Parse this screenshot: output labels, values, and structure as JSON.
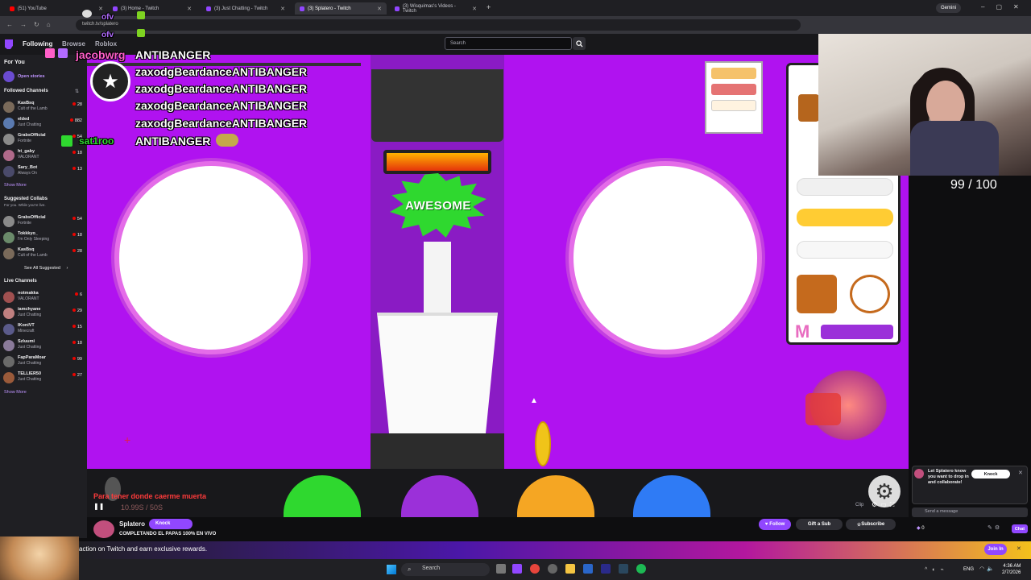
{
  "browser": {
    "tabs": [
      {
        "label": "(51) YouTube",
        "icon": "youtube-icon",
        "active": false
      },
      {
        "label": "(3) Home - Twitch",
        "icon": "twitch-icon",
        "active": false
      },
      {
        "label": "(3) Just Chatting - Twitch",
        "icon": "twitch-icon",
        "active": false
      },
      {
        "label": "(3) Splatero - Twitch",
        "icon": "twitch-icon",
        "active": true
      },
      {
        "label": "(3) Wisquimas's Videos - Twitch",
        "icon": "twitch-icon",
        "active": false
      }
    ],
    "url": "twitch.tv/splatero",
    "gemini_label": "Gemini"
  },
  "twitch_nav": {
    "following": "Following",
    "browse": "Browse",
    "roblox": "Roblox",
    "search_placeholder": "Search"
  },
  "sidebar": {
    "for_you": "For You",
    "open_stories": "Open stories",
    "followed_header": "Followed Channels",
    "followed": [
      {
        "name": "KasBsq",
        "game": "Cult of the Lamb",
        "viewers": "28"
      },
      {
        "name": "elded",
        "game": "Just Chatting",
        "viewers": "882"
      },
      {
        "name": "GrabsOfficial",
        "game": "Fortnite",
        "viewers": "54"
      },
      {
        "name": "ht_gaby",
        "game": "VALORANT",
        "viewers": "18"
      },
      {
        "name": "Sary_Bot",
        "game": "Always On",
        "viewers": "13"
      }
    ],
    "show_more_1": "Show More",
    "suggested_header": "Suggested Collabs",
    "suggested_sub": "For you. While you're live.",
    "suggested": [
      {
        "name": "GrabsOfficial",
        "game": "Fortnite",
        "viewers": "54"
      },
      {
        "name": "Tokkkyo_",
        "game": "I'm Only Sleeping",
        "viewers": "18"
      },
      {
        "name": "KasBsq",
        "game": "Cult of the Lamb",
        "viewers": "28"
      }
    ],
    "see_all_suggested": "See All Suggested",
    "live_header": "Live Channels",
    "live": [
      {
        "name": "notmakka",
        "game": "VALORANT",
        "viewers": "6"
      },
      {
        "name": "iamchyane",
        "game": "Just Chatting",
        "viewers": "29"
      },
      {
        "name": "IKoniVT",
        "game": "Minecraft",
        "viewers": "15"
      },
      {
        "name": "Szluumi",
        "game": "Just Chatting",
        "viewers": "18"
      },
      {
        "name": "FapParaMoar",
        "game": "Just Chatting",
        "viewers": "99"
      },
      {
        "name": "TELLIER50",
        "game": "Just Chatting",
        "viewers": "27"
      }
    ],
    "show_more_2": "Show More"
  },
  "overlay_chat": {
    "ofv_1": "ofv",
    "ofv_2": "ofv",
    "username": "jacobwrg",
    "lines": [
      "ANTIBANGER",
      "zaxodgBeardanceANTIBANGER",
      "zaxodgBeardanceANTIBANGER",
      "zaxodgBeardanceANTIBANGER",
      "zaxodgBeardanceANTIBANGER",
      "ANTIBANGER"
    ],
    "user2": "sat1roo"
  },
  "game": {
    "awesome_label": "AWESOME",
    "m_label": "M",
    "ticker_text": "Para tener donde caerme muerta",
    "ticker_sub": "10.99S / 50S"
  },
  "webcam": {
    "counter": "99 / 100"
  },
  "stream_info": {
    "streamer": "Splatero",
    "knock_label": "Knock",
    "title": "COMPLETANDO EL PAPAS 100% EN VIVO",
    "follow_label": "Follow",
    "gift_label": "Gift a Sub",
    "subscribe_label": "Subscribe",
    "clip_label": "Clip"
  },
  "chat_panel": {
    "collab_text": "Let Splatero know you want to drop in and collaborate!",
    "collab_knock": "Knock",
    "send_placeholder": "Send a message",
    "points": "0",
    "chat_button": "Chat"
  },
  "promo": {
    "text": "action on Twitch and earn exclusive rewards.",
    "join_label": "Join In"
  },
  "taskbar": {
    "search_label": "Search",
    "lang": "ENG",
    "time": "4:36 AM",
    "date": "2/7/2026"
  },
  "colors": {
    "twitch_purple": "#9147ff",
    "game_purple": "#b012f0",
    "awesome_green": "#2fd82f"
  }
}
